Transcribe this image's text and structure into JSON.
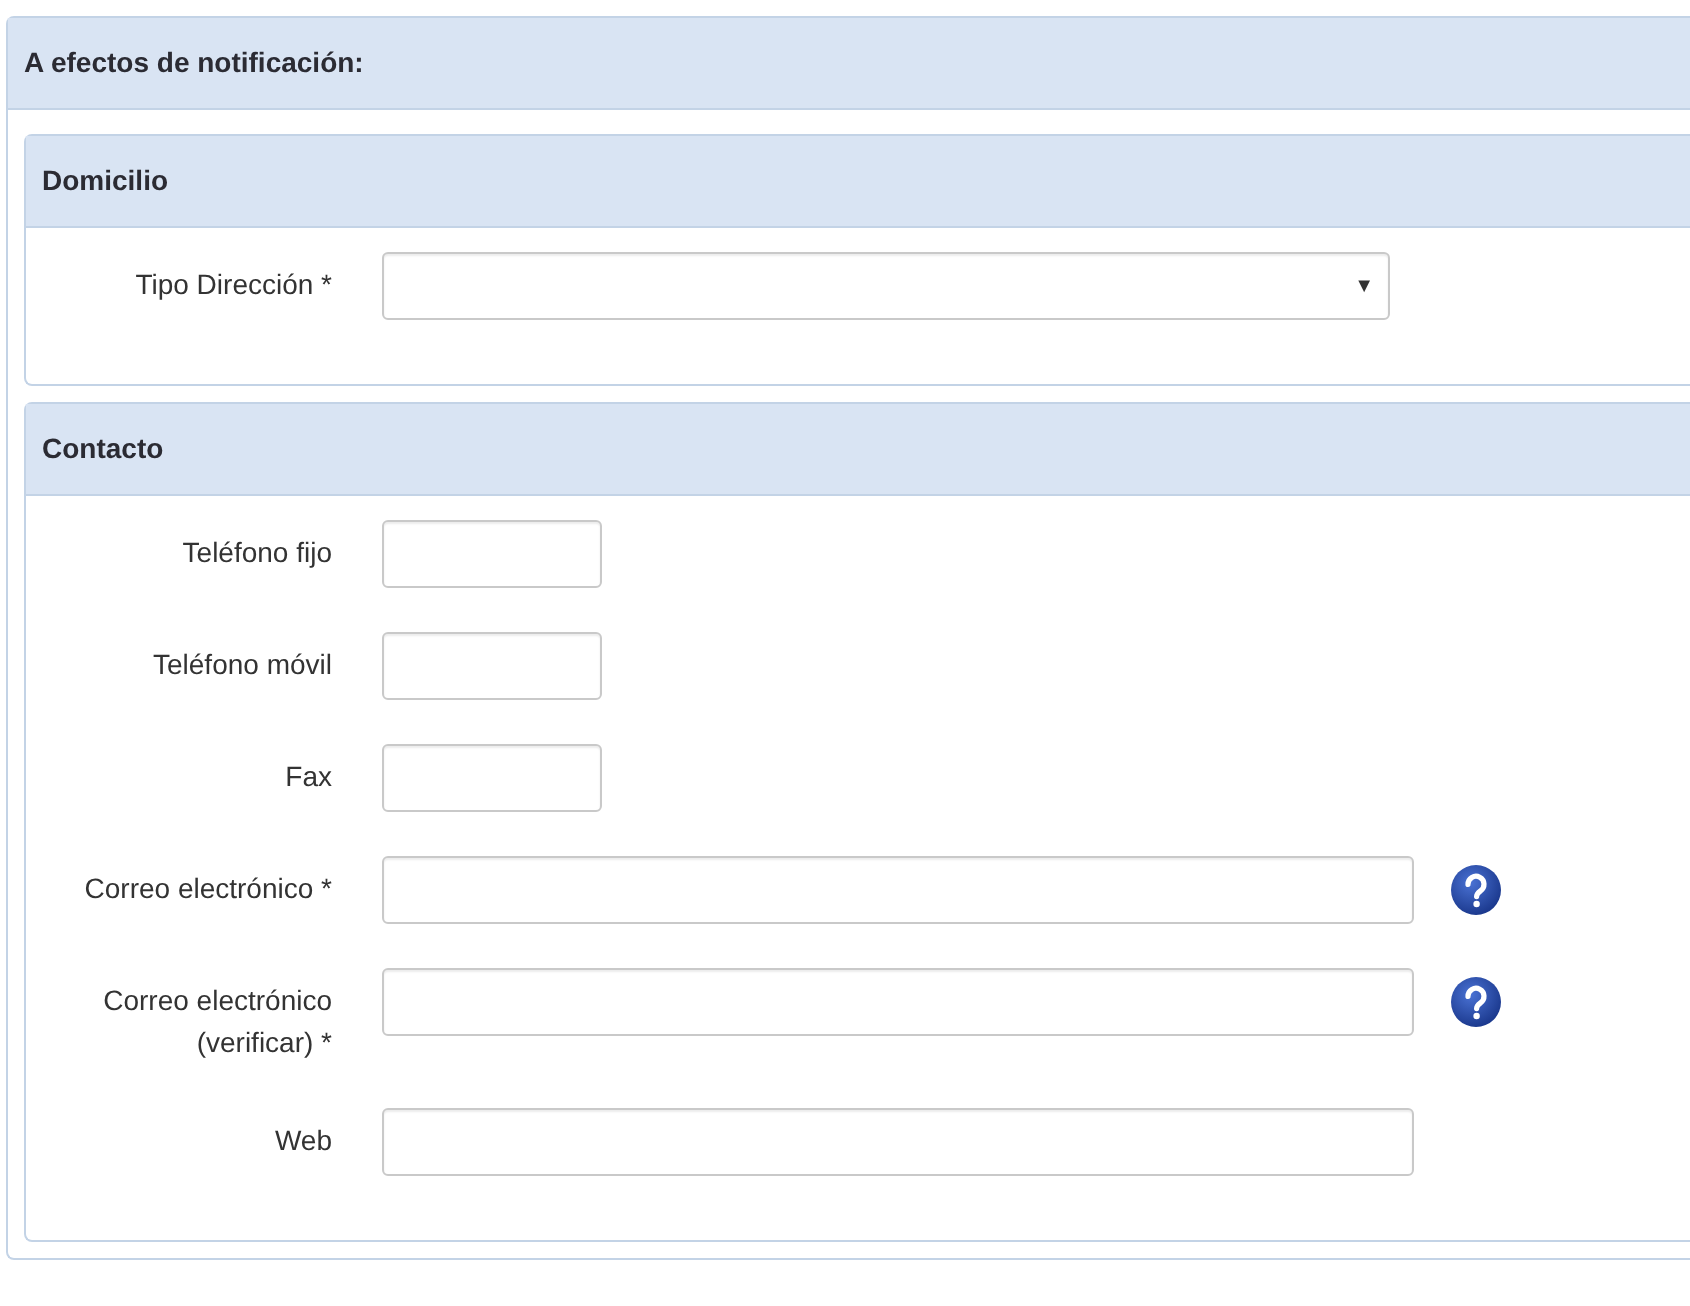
{
  "title": "A efectos de notificación:",
  "sections": [
    {
      "title": "Domicilio",
      "fields": [
        {
          "kind": "select",
          "label": "Tipo Dirección *",
          "caret": "▼",
          "help": false
        }
      ]
    },
    {
      "title": "Contacto",
      "fields": [
        {
          "kind": "short",
          "label": "Teléfono fijo",
          "help": false
        },
        {
          "kind": "short",
          "label": "Teléfono móvil",
          "help": false
        },
        {
          "kind": "short",
          "label": "Fax",
          "help": false
        },
        {
          "kind": "long",
          "label": "Correo electrónico *",
          "help": true
        },
        {
          "kind": "long",
          "label": "Correo electrónico\n(verificar) *",
          "help": true
        },
        {
          "kind": "long",
          "label": "Web",
          "help": false
        }
      ]
    }
  ]
}
